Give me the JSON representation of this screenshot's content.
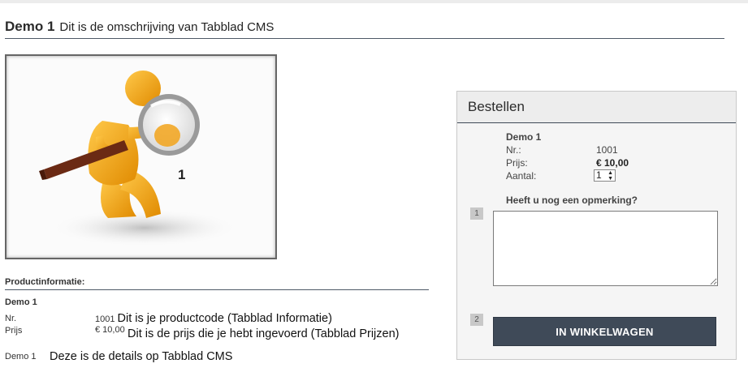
{
  "header": {
    "title": "Demo 1",
    "description": "Dit is de omschrijving van Tabblad CMS"
  },
  "image": {
    "label": "1"
  },
  "product_info": {
    "section_title": "Productinformatie:",
    "name": "Demo 1",
    "nr_label": "Nr.",
    "nr_value": "1001",
    "nr_note": "Dit is je productcode (Tabblad Informatie)",
    "price_label": "Prijs",
    "price_value": "€ 10,00",
    "price_note": "Dit is de prijs die je hebt ingevoerd (Tabblad Prijzen)",
    "detail_label": "Demo 1",
    "detail_text": "Deze is de details op Tabblad CMS"
  },
  "order_panel": {
    "title": "Bestellen",
    "product_name": "Demo 1",
    "nr_label": "Nr.:",
    "nr_value": "1001",
    "price_label": "Prijs:",
    "price_value": "€ 10,00",
    "quantity_label": "Aantal:",
    "quantity_value": "1",
    "remark_question": "Heeft u nog een opmerking?",
    "remark_value": "",
    "step1": "1",
    "step2": "2",
    "submit_label": "IN WINKELWAGEN"
  },
  "colors": {
    "button_bg": "#3f4a58",
    "figure_yellow": "#f2a31a"
  }
}
